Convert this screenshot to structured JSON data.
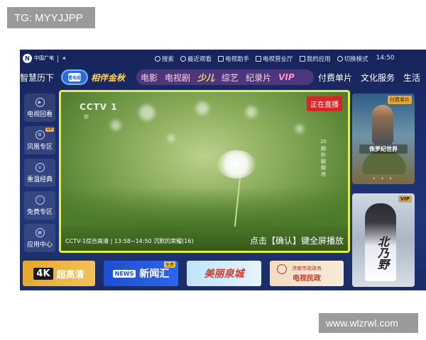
{
  "watermarks": {
    "top_left": "TG: MYYJJPP",
    "bottom_right": "www.wlzrwl.com"
  },
  "topbar": {
    "logo_text": "中国广电",
    "brand_text": "",
    "items": [
      "搜索",
      "最近观看",
      "电视助手",
      "电视营业厅",
      "我的应用",
      "切换模式"
    ],
    "time": "14:50"
  },
  "nav": {
    "left_label": "智慧历下",
    "tv_button_label": "看电视",
    "promo_text": "相伴金秋",
    "pill_items": [
      "电影",
      "电视剧",
      "少儿",
      "综艺",
      "纪录片"
    ],
    "vip_label": "VIP",
    "right_items": [
      "付费单片",
      "文化服务",
      "生活"
    ]
  },
  "sidebar": {
    "items": [
      {
        "label": "电视回看",
        "icon": "play-icon",
        "badge": ""
      },
      {
        "label": "凤凰专区",
        "icon": "phoenix-icon",
        "badge": "VIP"
      },
      {
        "label": "重温经典",
        "icon": "film-reel-icon",
        "badge": ""
      },
      {
        "label": "免费专区",
        "icon": "free-icon",
        "badge": ""
      },
      {
        "label": "应用中心",
        "icon": "grid-apps-icon",
        "badge": ""
      }
    ]
  },
  "video": {
    "channel_logo": "CCTV 1",
    "channel_sub": "综",
    "live_badge": "正在直播",
    "side_number": "20",
    "side_text": "翻秒翻翻地",
    "info": "CCTV-1综合高清 | 13:58~14:50  沉默的荣耀(16)",
    "hint": "点击【确认】键全屏播放"
  },
  "posters": {
    "p1": {
      "tag": "付费单片",
      "title": "侏罗纪世界",
      "dots": "• • •"
    },
    "p2": {
      "tag": "VIP",
      "title": "北乃野"
    }
  },
  "tiles": {
    "t1": {
      "tag": "4K",
      "text": "超高清"
    },
    "t2": {
      "tag": "NEWS",
      "text": "新闻汇",
      "badge": "免费"
    },
    "t3": {
      "text": "美丽泉城"
    },
    "t4": {
      "top": "济南市政政务",
      "main": "电视民政"
    }
  }
}
